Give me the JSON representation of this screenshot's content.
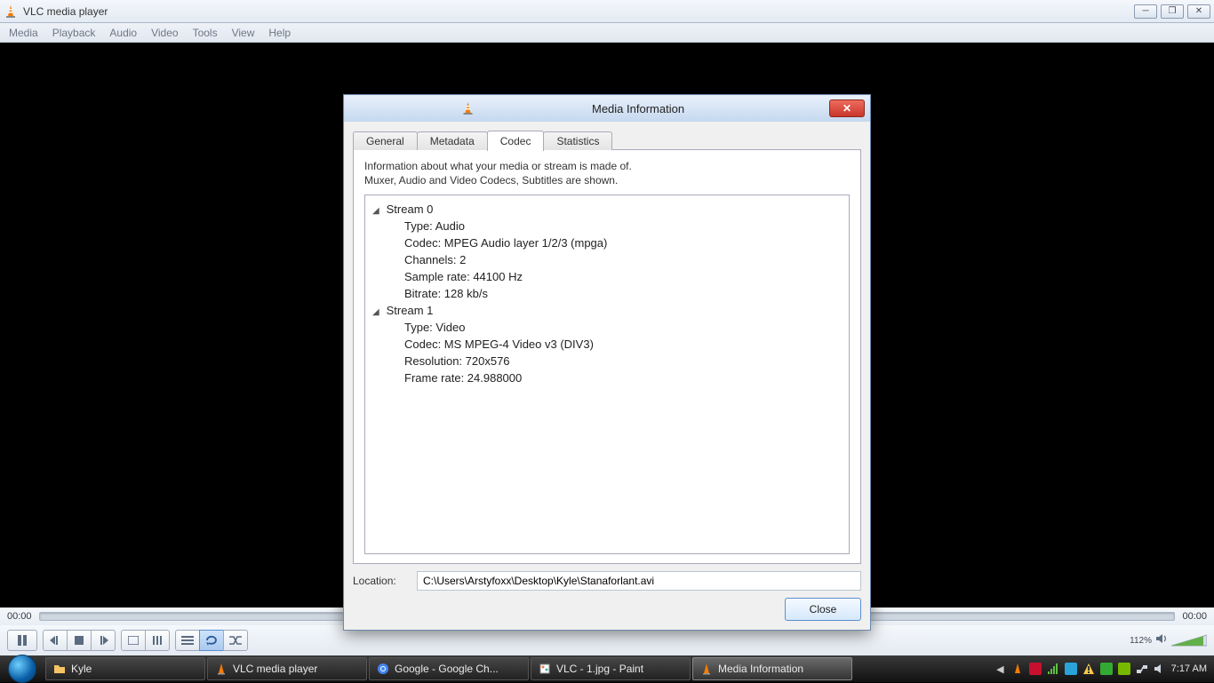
{
  "window": {
    "title": "VLC media player",
    "menus": [
      "Media",
      "Playback",
      "Audio",
      "Video",
      "Tools",
      "View",
      "Help"
    ],
    "time_left": "00:00",
    "time_right": "00:00",
    "volume_pct": "112%"
  },
  "dialog": {
    "title": "Media Information",
    "tabs": [
      "General",
      "Metadata",
      "Codec",
      "Statistics"
    ],
    "active_tab": 2,
    "description_line1": "Information about what your media or stream is made of.",
    "description_line2": "Muxer, Audio and Video Codecs, Subtitles are shown.",
    "streams": [
      {
        "label": "Stream 0",
        "props": [
          "Type: Audio",
          "Codec: MPEG Audio layer 1/2/3 (mpga)",
          "Channels: 2",
          "Sample rate: 44100 Hz",
          "Bitrate: 128 kb/s"
        ]
      },
      {
        "label": "Stream 1",
        "props": [
          "Type: Video",
          "Codec: MS MPEG-4 Video v3 (DIV3)",
          "Resolution: 720x576",
          "Frame rate: 24.988000"
        ]
      }
    ],
    "location_label": "Location:",
    "location_value": "C:\\Users\\Arstyfoxx\\Desktop\\Kyle\\Stanaforlant.avi",
    "close_label": "Close"
  },
  "taskbar": {
    "buttons": [
      {
        "label": "Kyle",
        "icon": "folder"
      },
      {
        "label": "VLC media player",
        "icon": "vlc"
      },
      {
        "label": "Google - Google Ch...",
        "icon": "chrome"
      },
      {
        "label": "VLC - 1.jpg - Paint",
        "icon": "paint"
      },
      {
        "label": "Media Information",
        "icon": "vlc",
        "active": true
      }
    ],
    "clock": "7:17 AM"
  }
}
